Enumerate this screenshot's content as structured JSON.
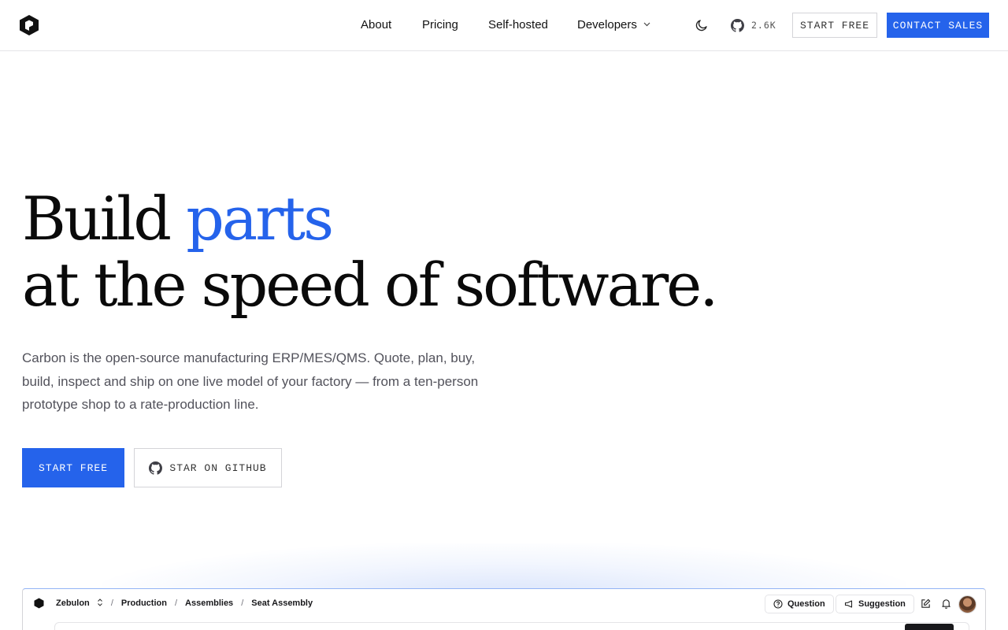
{
  "nav": {
    "links": [
      {
        "label": "About"
      },
      {
        "label": "Pricing"
      },
      {
        "label": "Self-hosted"
      },
      {
        "label": "Developers"
      }
    ],
    "github_stars": "2.6K",
    "start_free": "START FREE",
    "contact_sales": "CONTACT SALES"
  },
  "hero": {
    "headline_part1": "Build",
    "headline_accent": "parts",
    "headline_line2": "at the speed of software.",
    "subtitle": "Carbon is the open-source manufacturing ERP/MES/QMS. Quote, plan, buy, build, inspect and ship on one live model of your factory — from a ten-person prototype shop to a rate-production line.",
    "start_free": "START FREE",
    "star_github": "STAR ON GITHUB"
  },
  "preview": {
    "breadcrumbs": [
      "Zebulon",
      "Production",
      "Assemblies",
      "Seat Assembly"
    ],
    "question": "Question",
    "suggestion": "Suggestion"
  },
  "colors": {
    "accent": "#2563eb",
    "text": "#0a0a0a",
    "muted": "#52525b",
    "border": "#e4e4e7"
  },
  "icons": [
    "logo-icon",
    "chevron-down-icon",
    "moon-icon",
    "github-icon",
    "help-circle-icon",
    "megaphone-icon",
    "edit-icon",
    "bell-icon",
    "avatar"
  ]
}
